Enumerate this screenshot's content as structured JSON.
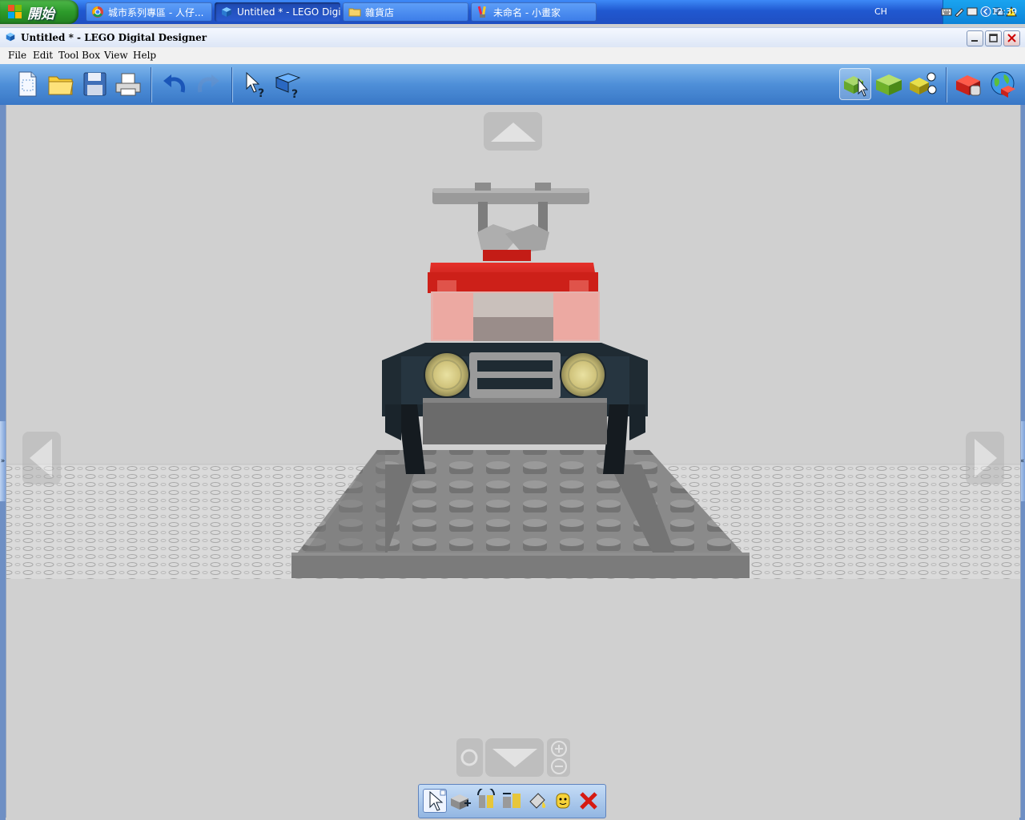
{
  "taskbar": {
    "start_label": "開始",
    "tasks": [
      {
        "label": "城市系列專區 - 人仔...",
        "icon": "chrome-icon"
      },
      {
        "label": "Untitled * - LEGO Digi...",
        "icon": "lego-designer-icon",
        "active": true
      },
      {
        "label": "雜貨店",
        "icon": "folder-icon"
      },
      {
        "label": "未命名 - 小畫家",
        "icon": "paint-icon"
      }
    ],
    "language": "CH",
    "clock": "12:39"
  },
  "window": {
    "title": "Untitled * - LEGO Digital Designer"
  },
  "menu": [
    "File",
    "Edit",
    "Tool Box",
    "View",
    "Help"
  ],
  "toolbar": {
    "left": [
      "new-file-icon",
      "open-folder-icon",
      "save-disk-icon",
      "print-icon",
      "undo-icon",
      "redo-icon",
      "select-help-icon",
      "guide-book-help-icon"
    ],
    "right": [
      "build-mode-icon",
      "view-mode-icon",
      "building-guide-mode-icon",
      "lego-order-icon",
      "lego-online-icon"
    ],
    "active_right": "build-mode-icon"
  },
  "bottom_toolbox": [
    "select-tool-icon",
    "clone-tool-icon",
    "hinge-tool-icon",
    "hinge-align-tool-icon",
    "paint-tool-icon",
    "minifig-tool-icon",
    "delete-tool-icon"
  ],
  "bottom_toolbox_active": "select-tool-icon",
  "colors": {
    "taskbar_blue": "#2058d0",
    "toolbar_blue": "#4e8fd8",
    "canvas_grey": "#d0d0d0",
    "brick_red": "#cc1f1a",
    "dark_bluish_grey": "#1f2b33",
    "light_grey_plate": "#8c8c8c"
  }
}
